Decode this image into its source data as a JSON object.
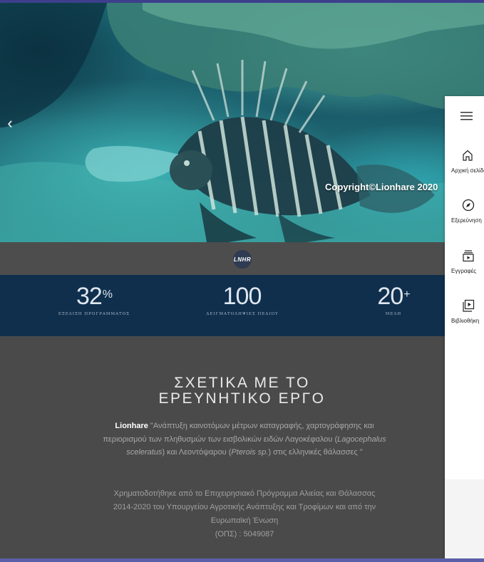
{
  "hero": {
    "prev_symbol": "‹",
    "copyright": "Copyright©Lionhare 2020"
  },
  "logo": {
    "text": "LNHR"
  },
  "stats": [
    {
      "value": "32",
      "suffix": "%",
      "label": "ΕΞΕΛΙΞΗ ΠΡΟΓΡΑΜΜΑΤΟΣ"
    },
    {
      "value": "100",
      "suffix": "",
      "label": "ΔΕΙΓΜΑΤΟΛΗΨΙΕΣ ΠΕΔΙΟΥ"
    },
    {
      "value": "20",
      "suffix": "+",
      "label": "ΜΕΛΗ"
    }
  ],
  "about": {
    "title_line1": "ΣΧΕΤΙΚΑ ΜΕ ΤΟ",
    "title_line2": "ΕΡΕΥΝΗΤΙΚΟ ΕΡΓΟ",
    "brand": "Lionhare",
    "desc_part1": " \"Ανάπτυξη καινοτόμων μέτρων καταγραφής, χαρτογράφησης και περιορισμού των πληθυσμών των εισβολικών ειδών Λαγοκέφαλου (",
    "species1": "Lagocephalus sceleratus",
    "desc_part2": ") και Λεοντόψαρου (",
    "species2": "Pterois sp.",
    "desc_part3": ") στις ελληνικές θάλασσες \"",
    "funding_line1": "Χρηματοδοτήθηκε από το Επιχειρησιακό Πρόγραμμα Αλιείας και Θάλασσας",
    "funding_line2": "2014-2020 του Υπουργείου Αγροτικής Ανάπτυξης και Τροφίμων και από την",
    "funding_line3": "Ευρωπαϊκή Ένωση",
    "funding_line4": "(ΟΠΣ) : 5049087"
  },
  "sidenav": {
    "items": [
      {
        "label": "Αρχική σελίδα",
        "icon": "home-icon"
      },
      {
        "label": "Εξερεύνηση",
        "icon": "compass-icon"
      },
      {
        "label": "Εγγραφές",
        "icon": "subscriptions-icon"
      },
      {
        "label": "Βιβλιοθήκη",
        "icon": "library-icon"
      }
    ]
  },
  "colors": {
    "frame": "#3e3f8c",
    "stats_bg": "#0f2f4d",
    "about_bg": "#4a4a4a",
    "logo_bar": "#4d4d4d"
  }
}
